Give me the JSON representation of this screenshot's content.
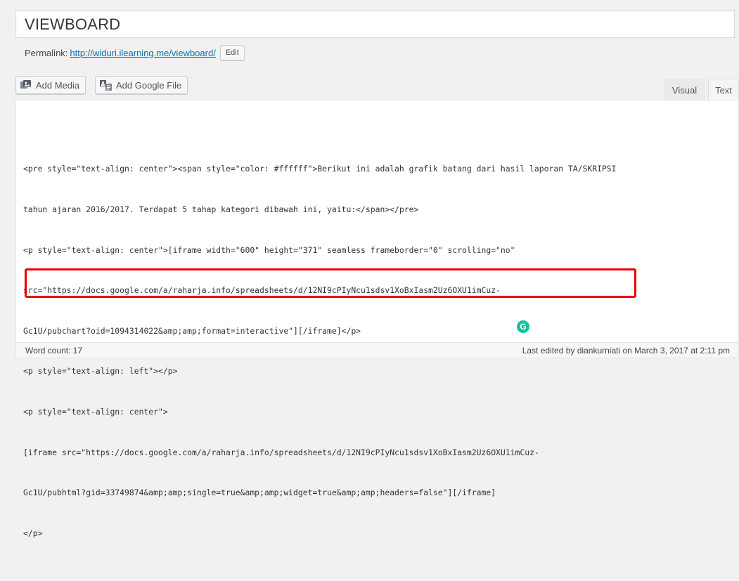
{
  "post": {
    "title": "VIEWBOARD"
  },
  "permalink": {
    "label": "Permalink:",
    "url": "http://widuri.ilearning.me/viewboard/",
    "edit_label": "Edit"
  },
  "toolbar": {
    "add_media_label": "Add Media",
    "add_google_file_label": "Add Google File"
  },
  "tabs": {
    "visual": "Visual",
    "text": "Text"
  },
  "editor": {
    "lines": [
      "<pre style=\"text-align: center\"><span style=\"color: #ffffff\">Berikut ini adalah grafik batang dari hasil laporan TA/SKRIPSI",
      "tahun ajaran 2016/2017. Terdapat 5 tahap kategori dibawah ini, yaitu:</span></pre>",
      "<p style=\"text-align: center\">[iframe width=\"600\" height=\"371\" seamless frameborder=\"0\" scrolling=\"no\"",
      "src=\"https://docs.google.com/a/raharja.info/spreadsheets/d/12NI9cPIyNcu1sdsv1XoBxIasm2Uz6OXU1imCuz-",
      "Gc1U/pubchart?oid=1094314022&amp;amp;format=interactive\"][/iframe]</p>",
      "<p style=\"text-align: left\"></p>",
      "<p style=\"text-align: center\">",
      "[iframe src=\"https://docs.google.com/a/raharja.info/spreadsheets/d/12NI9cPIyNcu1sdsv1XoBxIasm2Uz6OXU1imCuz-",
      "Gc1U/pubhtml?gid=33749874&amp;amp;single=true&amp;amp;widget=true&amp;amp;headers=false\"][/iframe]",
      "</p>"
    ]
  },
  "grammarly": {
    "glyph": "G"
  },
  "status": {
    "word_count": "Word count: 17",
    "last_edited": "Last edited by diankurniati on March 3, 2017 at 2:11 pm"
  },
  "colors": {
    "highlight": "#e00000",
    "link": "#0073aa",
    "grammarly": "#15c39a"
  }
}
